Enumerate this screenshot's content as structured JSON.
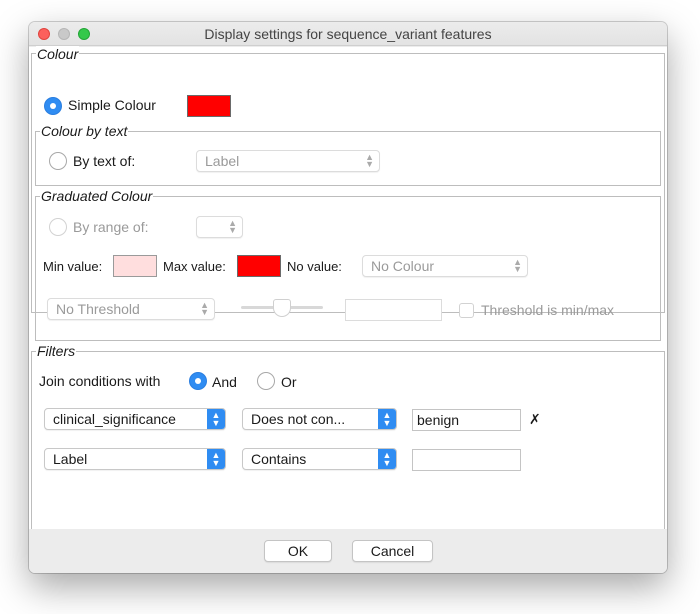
{
  "window": {
    "title": "Display settings for sequence_variant features"
  },
  "colour": {
    "legend": "Colour",
    "simple_colour_label": "Simple Colour",
    "simple_colour_selected": true,
    "simple_colour_swatch": "#ff0000",
    "by_text": {
      "legend": "Colour by text",
      "radio_label": "By text of:",
      "combo_value": "Label"
    },
    "graduated": {
      "legend": "Graduated Colour",
      "radio_label": "By range of:",
      "combo_value": "",
      "min_label": "Min value:",
      "min_colour": "#ffdede",
      "max_label": "Max value:",
      "max_colour": "#ff0000",
      "no_value_label": "No value:",
      "no_value_combo": "No Colour",
      "threshold_combo": "No Threshold",
      "threshold_value": "",
      "threshold_checkbox_label": "Threshold is min/max"
    }
  },
  "filters": {
    "legend": "Filters",
    "join_label": "Join conditions with",
    "and_label": "And",
    "or_label": "Or",
    "and_selected": true,
    "conditions": [
      {
        "attribute": "clinical_significance",
        "operator": "Does not con...",
        "value": "benign",
        "remove_glyph": "✗"
      },
      {
        "attribute": "Label",
        "operator": "Contains",
        "value": ""
      }
    ]
  },
  "buttons": {
    "ok": "OK",
    "cancel": "Cancel"
  },
  "colors": {
    "accent": "#2f8cf2"
  }
}
